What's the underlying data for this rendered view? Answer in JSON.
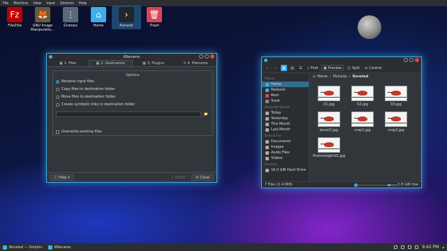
{
  "menubar": [
    "File",
    "Machine",
    "View",
    "Input",
    "Devices",
    "Help"
  ],
  "desktop_icons": [
    {
      "label": "FileZilla",
      "icon": "filezilla-icon",
      "color": "#bf0000"
    },
    {
      "label": "GNU Image Manipulatio…",
      "icon": "gimp-icon",
      "color": "#6b5a3a"
    },
    {
      "label": "Gramps",
      "icon": "gramps-icon",
      "color": "#5a6a7a"
    },
    {
      "label": "Home",
      "icon": "home-folder-icon",
      "color": "#3daee9"
    },
    {
      "label": "Konsole",
      "icon": "konsole-icon",
      "color": "#232629"
    },
    {
      "label": "Trash",
      "icon": "trash-folder-icon",
      "color": "#da4453"
    }
  ],
  "krename": {
    "title": "KRename",
    "tabs": [
      "1. Files",
      "2. Destination",
      "3. Plugins",
      "4. Filename"
    ],
    "active_tab": 1,
    "options_title": "Options",
    "radios": [
      "Rename input files",
      "Copy files to destination folder",
      "Move files to destination folder",
      "Create symbolic links in destination folder"
    ],
    "selected_radio": 0,
    "overwrite_label": "Overwrite existing files",
    "help": "Help",
    "finish": "Finish",
    "close": "Close"
  },
  "dolphin": {
    "title": "Beveled — Dolphin",
    "toolbar": {
      "find": "Find",
      "preview": "Preview",
      "split": "Split",
      "control": "Control"
    },
    "breadcrumb": [
      "Home",
      "Pictures",
      "Beveled"
    ],
    "places": [
      {
        "section": "Places",
        "items": [
          "Home",
          "Network",
          "Root",
          "Trash"
        ]
      },
      {
        "section": "Recently Saved",
        "items": [
          "Today",
          "Yesterday",
          "This Month",
          "Last Month"
        ]
      },
      {
        "section": "Search For",
        "items": [
          "Documents",
          "Images",
          "Audio Files",
          "Videos"
        ]
      },
      {
        "section": "Devices",
        "items": [
          "16.0 GiB Hard Drive"
        ]
      }
    ],
    "files": [
      "01.jpg",
      "02.jpg",
      "03.jpg",
      "bevel2.jpg",
      "crop1.jpg",
      "crop2.jpg",
      "Hummingbird1.jpg"
    ],
    "status_left": "7 Files (2.4 MiB)",
    "status_right": "5.8 GiB free",
    "free_fraction": 0.3
  },
  "taskbar": {
    "tasks": [
      "Beveled — Dolphin",
      "KRename"
    ],
    "clock": "9:42 PM"
  }
}
